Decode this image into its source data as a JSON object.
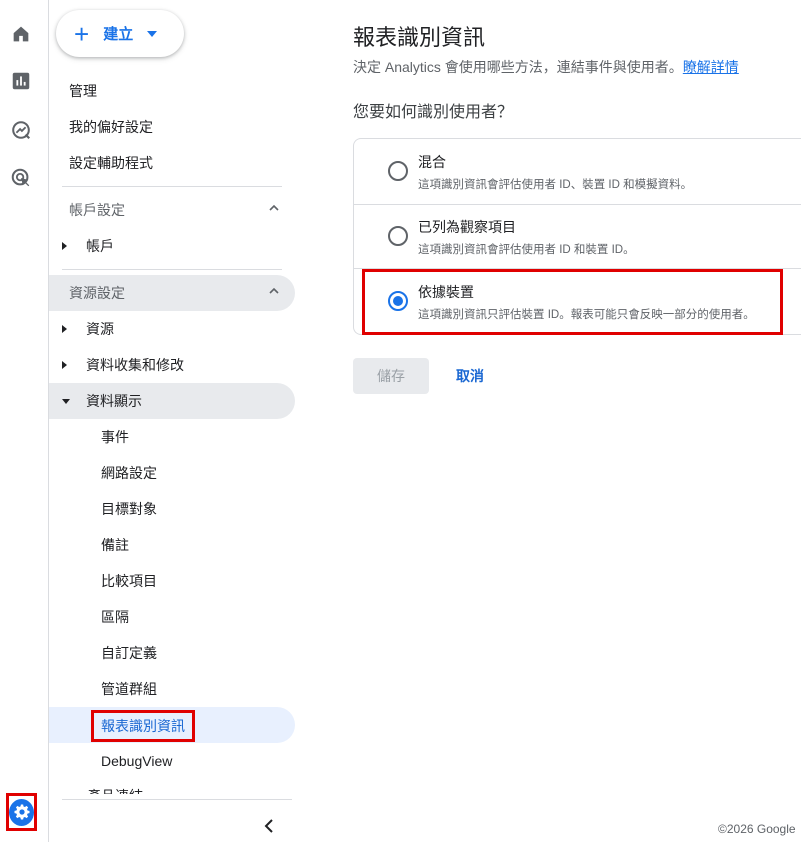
{
  "nav": {
    "create_label": "建立",
    "items": [
      "管理",
      "我的偏好設定",
      "設定輔助程式"
    ],
    "account_section": "帳戶設定",
    "account_item": "帳戶",
    "property_section": "資源設定",
    "tree": [
      "資源",
      "資料收集和修改",
      "資料顯示"
    ],
    "sub_items": [
      "事件",
      "網路設定",
      "目標對象",
      "備註",
      "比較項目",
      "區隔",
      "自訂定義",
      "管道群組"
    ],
    "active_item": "報表識別資訊",
    "debug_item": "DebugView",
    "cut_item": "產品連結"
  },
  "page": {
    "title": "報表識別資訊",
    "desc": "決定 Analytics 會使用哪些方法，連結事件與使用者。",
    "learn_more": "瞭解詳情",
    "question": "您要如何識別使用者？",
    "options": [
      {
        "title": "混合",
        "desc": "這項識別資訊會評估使用者 ID、裝置 ID 和模擬資料。",
        "selected": false
      },
      {
        "title": "已列為觀察項目",
        "desc": "這項識別資訊會評估使用者 ID 和裝置 ID。",
        "selected": false
      },
      {
        "title": "依據裝置",
        "desc": "這項識別資訊只評估裝置 ID。報表可能只會反映一部分的使用者。",
        "selected": true
      }
    ],
    "save_label": "儲存",
    "cancel_label": "取消",
    "footer": "©2026 Google"
  },
  "colors": {
    "accent": "#1a73e8",
    "highlight_box": "#e00000"
  },
  "icons": [
    "home-icon",
    "reports-icon",
    "explore-icon",
    "advertising-icon",
    "settings-icon",
    "chevron-left-icon"
  ]
}
